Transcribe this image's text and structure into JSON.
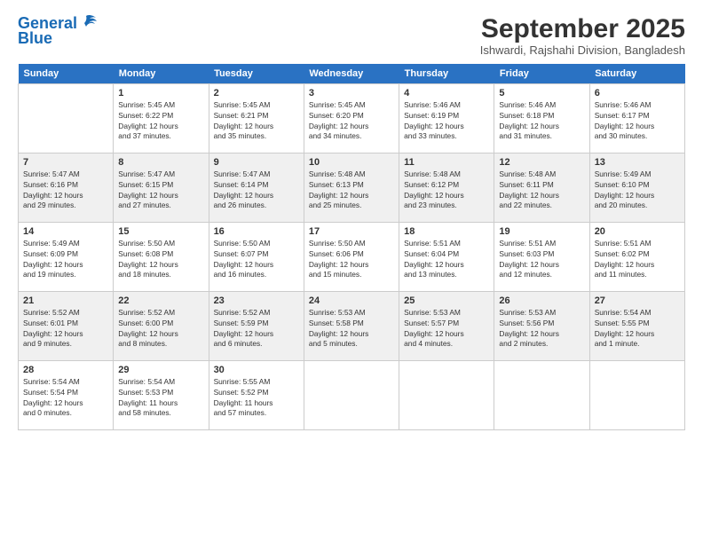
{
  "header": {
    "logo_line1": "General",
    "logo_line2": "Blue",
    "month_title": "September 2025",
    "subtitle": "Ishwardi, Rajshahi Division, Bangladesh"
  },
  "days_of_week": [
    "Sunday",
    "Monday",
    "Tuesday",
    "Wednesday",
    "Thursday",
    "Friday",
    "Saturday"
  ],
  "weeks": [
    [
      {
        "num": "",
        "info": ""
      },
      {
        "num": "1",
        "info": "Sunrise: 5:45 AM\nSunset: 6:22 PM\nDaylight: 12 hours\nand 37 minutes."
      },
      {
        "num": "2",
        "info": "Sunrise: 5:45 AM\nSunset: 6:21 PM\nDaylight: 12 hours\nand 35 minutes."
      },
      {
        "num": "3",
        "info": "Sunrise: 5:45 AM\nSunset: 6:20 PM\nDaylight: 12 hours\nand 34 minutes."
      },
      {
        "num": "4",
        "info": "Sunrise: 5:46 AM\nSunset: 6:19 PM\nDaylight: 12 hours\nand 33 minutes."
      },
      {
        "num": "5",
        "info": "Sunrise: 5:46 AM\nSunset: 6:18 PM\nDaylight: 12 hours\nand 31 minutes."
      },
      {
        "num": "6",
        "info": "Sunrise: 5:46 AM\nSunset: 6:17 PM\nDaylight: 12 hours\nand 30 minutes."
      }
    ],
    [
      {
        "num": "7",
        "info": "Sunrise: 5:47 AM\nSunset: 6:16 PM\nDaylight: 12 hours\nand 29 minutes."
      },
      {
        "num": "8",
        "info": "Sunrise: 5:47 AM\nSunset: 6:15 PM\nDaylight: 12 hours\nand 27 minutes."
      },
      {
        "num": "9",
        "info": "Sunrise: 5:47 AM\nSunset: 6:14 PM\nDaylight: 12 hours\nand 26 minutes."
      },
      {
        "num": "10",
        "info": "Sunrise: 5:48 AM\nSunset: 6:13 PM\nDaylight: 12 hours\nand 25 minutes."
      },
      {
        "num": "11",
        "info": "Sunrise: 5:48 AM\nSunset: 6:12 PM\nDaylight: 12 hours\nand 23 minutes."
      },
      {
        "num": "12",
        "info": "Sunrise: 5:48 AM\nSunset: 6:11 PM\nDaylight: 12 hours\nand 22 minutes."
      },
      {
        "num": "13",
        "info": "Sunrise: 5:49 AM\nSunset: 6:10 PM\nDaylight: 12 hours\nand 20 minutes."
      }
    ],
    [
      {
        "num": "14",
        "info": "Sunrise: 5:49 AM\nSunset: 6:09 PM\nDaylight: 12 hours\nand 19 minutes."
      },
      {
        "num": "15",
        "info": "Sunrise: 5:50 AM\nSunset: 6:08 PM\nDaylight: 12 hours\nand 18 minutes."
      },
      {
        "num": "16",
        "info": "Sunrise: 5:50 AM\nSunset: 6:07 PM\nDaylight: 12 hours\nand 16 minutes."
      },
      {
        "num": "17",
        "info": "Sunrise: 5:50 AM\nSunset: 6:06 PM\nDaylight: 12 hours\nand 15 minutes."
      },
      {
        "num": "18",
        "info": "Sunrise: 5:51 AM\nSunset: 6:04 PM\nDaylight: 12 hours\nand 13 minutes."
      },
      {
        "num": "19",
        "info": "Sunrise: 5:51 AM\nSunset: 6:03 PM\nDaylight: 12 hours\nand 12 minutes."
      },
      {
        "num": "20",
        "info": "Sunrise: 5:51 AM\nSunset: 6:02 PM\nDaylight: 12 hours\nand 11 minutes."
      }
    ],
    [
      {
        "num": "21",
        "info": "Sunrise: 5:52 AM\nSunset: 6:01 PM\nDaylight: 12 hours\nand 9 minutes."
      },
      {
        "num": "22",
        "info": "Sunrise: 5:52 AM\nSunset: 6:00 PM\nDaylight: 12 hours\nand 8 minutes."
      },
      {
        "num": "23",
        "info": "Sunrise: 5:52 AM\nSunset: 5:59 PM\nDaylight: 12 hours\nand 6 minutes."
      },
      {
        "num": "24",
        "info": "Sunrise: 5:53 AM\nSunset: 5:58 PM\nDaylight: 12 hours\nand 5 minutes."
      },
      {
        "num": "25",
        "info": "Sunrise: 5:53 AM\nSunset: 5:57 PM\nDaylight: 12 hours\nand 4 minutes."
      },
      {
        "num": "26",
        "info": "Sunrise: 5:53 AM\nSunset: 5:56 PM\nDaylight: 12 hours\nand 2 minutes."
      },
      {
        "num": "27",
        "info": "Sunrise: 5:54 AM\nSunset: 5:55 PM\nDaylight: 12 hours\nand 1 minute."
      }
    ],
    [
      {
        "num": "28",
        "info": "Sunrise: 5:54 AM\nSunset: 5:54 PM\nDaylight: 12 hours\nand 0 minutes."
      },
      {
        "num": "29",
        "info": "Sunrise: 5:54 AM\nSunset: 5:53 PM\nDaylight: 11 hours\nand 58 minutes."
      },
      {
        "num": "30",
        "info": "Sunrise: 5:55 AM\nSunset: 5:52 PM\nDaylight: 11 hours\nand 57 minutes."
      },
      {
        "num": "",
        "info": ""
      },
      {
        "num": "",
        "info": ""
      },
      {
        "num": "",
        "info": ""
      },
      {
        "num": "",
        "info": ""
      }
    ]
  ]
}
